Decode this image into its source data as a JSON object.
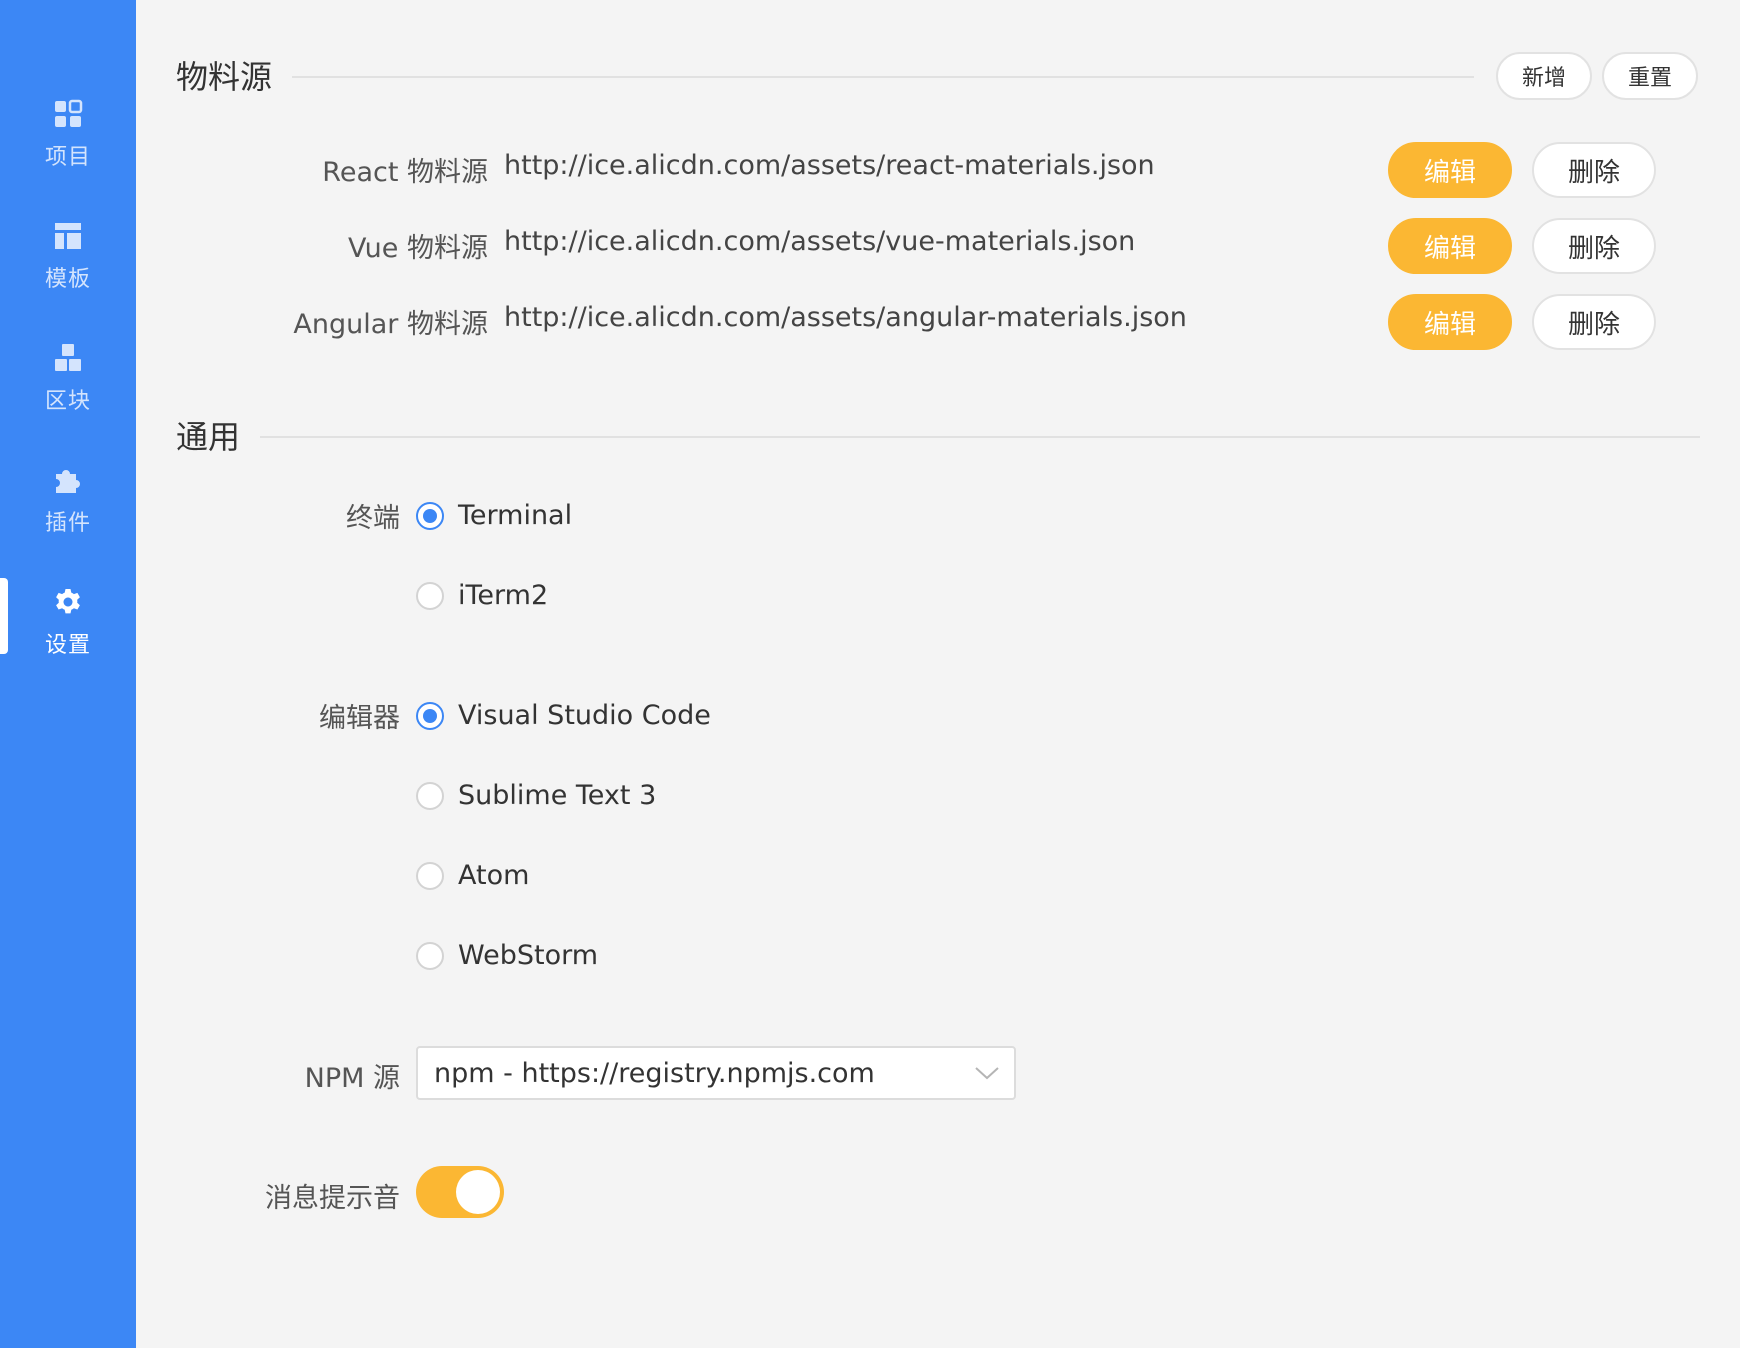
{
  "sidebar": {
    "items": [
      {
        "label": "项目",
        "icon": "grid-icon"
      },
      {
        "label": "模板",
        "icon": "layout-icon"
      },
      {
        "label": "区块",
        "icon": "blocks-icon"
      },
      {
        "label": "插件",
        "icon": "puzzle-icon"
      },
      {
        "label": "设置",
        "icon": "gear-icon"
      }
    ],
    "active_index": 4
  },
  "materials": {
    "title": "物料源",
    "add_label": "新增",
    "reset_label": "重置",
    "edit_label": "编辑",
    "delete_label": "删除",
    "rows": [
      {
        "name": "React 物料源",
        "url": "http://ice.alicdn.com/assets/react-materials.json"
      },
      {
        "name": "Vue 物料源",
        "url": "http://ice.alicdn.com/assets/vue-materials.json"
      },
      {
        "name": "Angular 物料源",
        "url": "http://ice.alicdn.com/assets/angular-materials.json"
      }
    ]
  },
  "general": {
    "title": "通用",
    "terminal": {
      "label": "终端",
      "options": [
        "Terminal",
        "iTerm2"
      ],
      "selected": "Terminal"
    },
    "editor": {
      "label": "编辑器",
      "options": [
        "Visual Studio Code",
        "Sublime Text 3",
        "Atom",
        "WebStorm"
      ],
      "selected": "Visual Studio Code"
    },
    "npm": {
      "label": "NPM 源",
      "selected": "npm - https://registry.npmjs.com"
    },
    "notification": {
      "label": "消息提示音",
      "enabled": true
    }
  },
  "colors": {
    "sidebar_bg": "#3c87f5",
    "accent": "#fbb733",
    "radio_checked": "#3c87f5",
    "page_bg": "#f4f4f4"
  }
}
